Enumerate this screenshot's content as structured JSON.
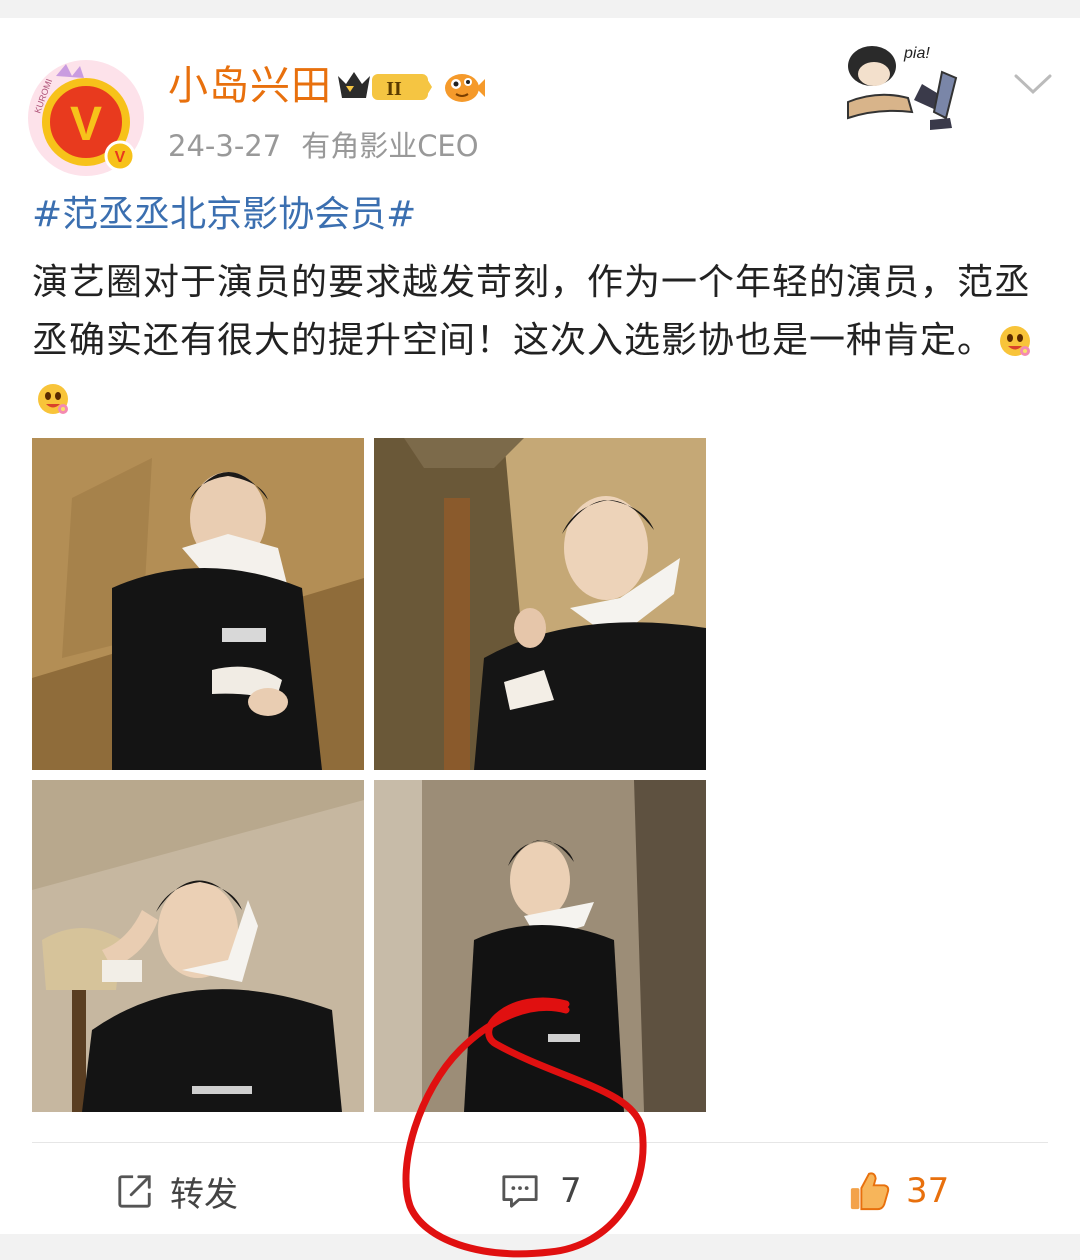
{
  "post": {
    "username": "小岛兴田",
    "vip_level": "II",
    "date": "24-3-27",
    "user_title": "有角影业CEO",
    "topic": "#范丞丞北京影协会员#",
    "body": "演艺圈对于演员的要求越发苛刻，作为一个年轻的演员，范丞丞确实还有很大的提升空间！这次入选影协也是一种肯定。",
    "decoration_text": "pia!",
    "avatar_badge_text": "KUROMI"
  },
  "actions": {
    "repost_label": "转发",
    "comment_count": "7",
    "like_count": "37"
  },
  "colors": {
    "username": "#e8700d",
    "topic": "#3b6fb0",
    "like": "#e8700d",
    "annotation": "#e01010"
  },
  "icons": [
    "repost-icon",
    "comment-icon",
    "like-icon",
    "chevron-down-icon",
    "vip-crown-icon",
    "fish-badge-icon",
    "smile-flower-emoji"
  ]
}
